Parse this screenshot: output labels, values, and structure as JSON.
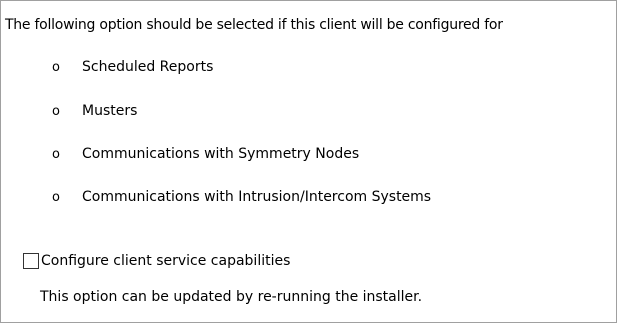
{
  "intro_text": "The following option should be selected if this client will be configured for",
  "bullet_glyph": "o",
  "bullets": [
    "Scheduled Reports",
    "Musters",
    "Communications with Symmetry Nodes",
    "Communications with Intrusion/Intercom Systems"
  ],
  "checkbox": {
    "label": "Configure client service capabilities",
    "checked": false
  },
  "note_text": "This option can be updated by re-running the installer."
}
